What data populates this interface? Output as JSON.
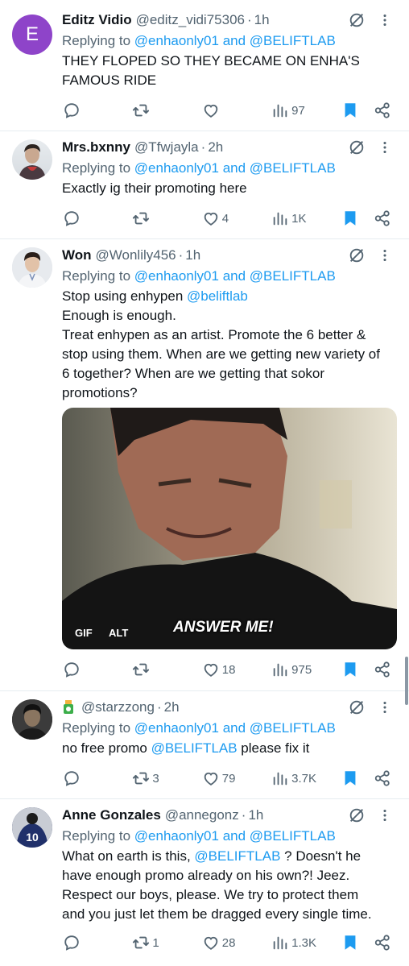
{
  "tweets": [
    {
      "avatar_letter": "E",
      "avatar_color": "#8e44c9",
      "name": "Editz Vidio",
      "handle": "@editz_vidi75306",
      "time": "1h",
      "reply_prefix": "Replying to",
      "reply_mentions": "@enhaonly01 and @BELIFTLAB",
      "body_lines": [
        "THEY FLOPED SO THEY BECAME ON ENHA'S",
        "FAMOUS RIDE"
      ],
      "stats": {
        "reply": "",
        "retweet": "",
        "like": "",
        "views": "97"
      }
    },
    {
      "avatar_icon": "profile-photo-man",
      "name": "Mrs.bxnny",
      "handle": "@Tfwjayla",
      "time": "2h",
      "reply_prefix": "Replying to",
      "reply_mentions": "@enhaonly01 and @BELIFTLAB",
      "body_lines": [
        "Exactly ig their promoting here"
      ],
      "stats": {
        "reply": "",
        "retweet": "",
        "like": "4",
        "views": "1K"
      }
    },
    {
      "avatar_icon": "profile-photo-man-white-shirt",
      "name": "Won",
      "handle": "@Wonlily456",
      "time": "1h",
      "reply_prefix": "Replying to",
      "reply_mentions": "@enhaonly01 and @BELIFTLAB",
      "body_first_pre": "Stop using enhypen ",
      "body_first_mention": "@beliftlab",
      "body_lines": [
        "Enough is enough.",
        "Treat enhypen as an artist. Promote the 6 better &",
        "stop using them. When are we getting new variety of",
        "6 together? When are we getting that sokor",
        "promotions?"
      ],
      "media": {
        "caption": "ANSWER ME!",
        "gif_badge": "GIF",
        "alt_badge": "ALT"
      },
      "stats": {
        "reply": "",
        "retweet": "",
        "like": "18",
        "views": "975"
      }
    },
    {
      "avatar_icon": "profile-photo-man-dark",
      "name_emoji": "cup-emoji",
      "name": "",
      "handle": "@starzzong",
      "time": "2h",
      "reply_prefix": "Replying to",
      "reply_mentions": "@enhaonly01 and @BELIFTLAB",
      "body_pre": "no free promo ",
      "body_mention": "@BELIFTLAB",
      "body_post": " please fix it",
      "stats": {
        "reply": "",
        "retweet": "3",
        "like": "79",
        "views": "3.7K"
      }
    },
    {
      "avatar_icon": "profile-photo-jersey-10",
      "name": "Anne Gonzales",
      "handle": "@annegonz",
      "time": "1h",
      "reply_prefix": "Replying to",
      "reply_mentions": "@enhaonly01 and @BELIFTLAB",
      "body_first_pre": "What on earth is this, ",
      "body_first_mention": "@BELIFTLAB",
      "body_first_post": " ? Doesn't he",
      "body_lines": [
        "have enough promo already on his own?! Jeez.",
        "Respect our boys, please. We try to protect them",
        "and you just let them be dragged every single time."
      ],
      "stats": {
        "reply": "",
        "retweet": "1",
        "like": "28",
        "views": "1.3K"
      }
    }
  ],
  "colors": {
    "accent": "#1d9bf0",
    "secondary_text": "#536471",
    "bookmark": "#1d9bf0"
  },
  "dot": "·"
}
